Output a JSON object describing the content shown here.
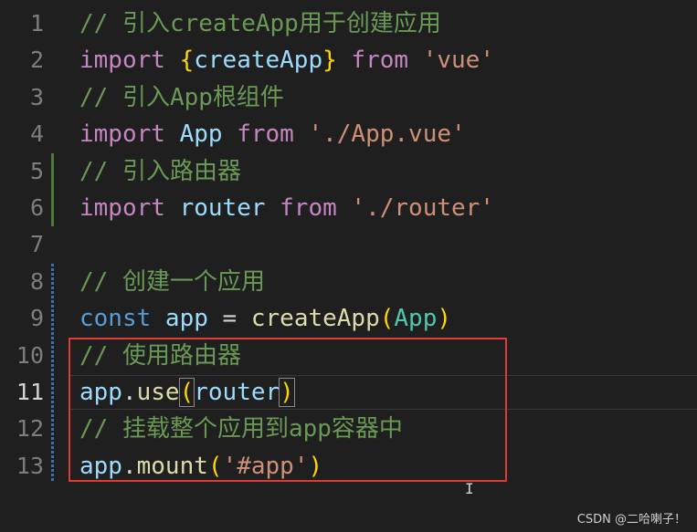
{
  "colors": {
    "background": "#1f1f1f",
    "comment": "#6a9955",
    "keyword": "#c586c0",
    "storage": "#569cd6",
    "variable": "#9cdcfe",
    "function": "#dcdcaa",
    "class": "#4ec9b0",
    "string": "#ce9178",
    "bracket": "#ffd700",
    "plain": "#d4d4d4",
    "highlight_box": "#e03a34"
  },
  "editor": {
    "active_line": 11,
    "lines": [
      {
        "num": "1",
        "tokens": [
          {
            "t": "// 引入createApp用于创建应用",
            "c": "comment"
          }
        ]
      },
      {
        "num": "2",
        "tokens": [
          {
            "t": "import ",
            "c": "keyword"
          },
          {
            "t": "{",
            "c": "bracket"
          },
          {
            "t": "createApp",
            "c": "variable"
          },
          {
            "t": "}",
            "c": "bracket"
          },
          {
            "t": " from ",
            "c": "keyword"
          },
          {
            "t": "'vue'",
            "c": "string"
          }
        ]
      },
      {
        "num": "3",
        "tokens": [
          {
            "t": "// 引入App根组件",
            "c": "comment"
          }
        ]
      },
      {
        "num": "4",
        "tokens": [
          {
            "t": "import ",
            "c": "keyword"
          },
          {
            "t": "App",
            "c": "variable"
          },
          {
            "t": " from ",
            "c": "keyword"
          },
          {
            "t": "'./App.vue'",
            "c": "string"
          }
        ]
      },
      {
        "num": "5",
        "tokens": [
          {
            "t": "// 引入路由器",
            "c": "comment"
          }
        ]
      },
      {
        "num": "6",
        "tokens": [
          {
            "t": "import ",
            "c": "keyword"
          },
          {
            "t": "router",
            "c": "variable"
          },
          {
            "t": " from ",
            "c": "keyword"
          },
          {
            "t": "'./router'",
            "c": "string"
          }
        ]
      },
      {
        "num": "7",
        "tokens": []
      },
      {
        "num": "8",
        "tokens": [
          {
            "t": "// 创建一个应用",
            "c": "comment"
          }
        ]
      },
      {
        "num": "9",
        "tokens": [
          {
            "t": "const ",
            "c": "storage"
          },
          {
            "t": "app",
            "c": "variable"
          },
          {
            "t": " = ",
            "c": "plain"
          },
          {
            "t": "createApp",
            "c": "function"
          },
          {
            "t": "(",
            "c": "bracket"
          },
          {
            "t": "App",
            "c": "class"
          },
          {
            "t": ")",
            "c": "bracket"
          }
        ]
      },
      {
        "num": "10",
        "tokens": [
          {
            "t": "// 使用路由器",
            "c": "comment"
          }
        ]
      },
      {
        "num": "11",
        "tokens": [
          {
            "t": "app",
            "c": "variable"
          },
          {
            "t": ".",
            "c": "plain"
          },
          {
            "t": "use",
            "c": "function"
          },
          {
            "t": "(",
            "c": "bracket",
            "match": true
          },
          {
            "t": "router",
            "c": "variable"
          },
          {
            "t": ")",
            "c": "bracket",
            "match": true
          }
        ]
      },
      {
        "num": "12",
        "tokens": [
          {
            "t": "// 挂载整个应用到app容器中",
            "c": "comment"
          }
        ]
      },
      {
        "num": "13",
        "tokens": [
          {
            "t": "app",
            "c": "variable"
          },
          {
            "t": ".",
            "c": "plain"
          },
          {
            "t": "mount",
            "c": "function"
          },
          {
            "t": "(",
            "c": "bracket"
          },
          {
            "t": "'#app'",
            "c": "string"
          },
          {
            "t": ")",
            "c": "bracket"
          }
        ]
      }
    ]
  },
  "watermark": "CSDN @二哈喇子！",
  "cursor_glyph": "I"
}
